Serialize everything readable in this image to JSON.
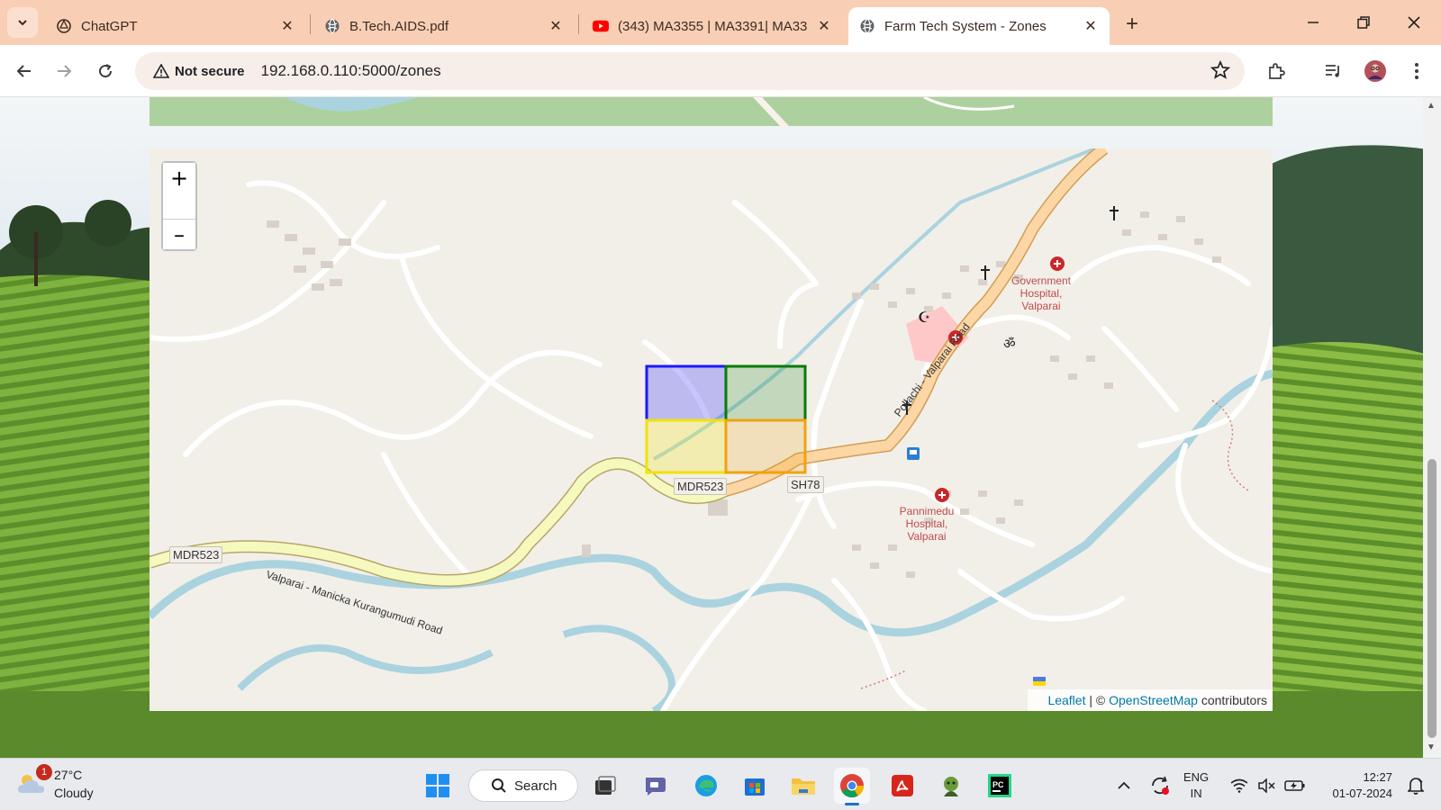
{
  "browser": {
    "tabs": [
      {
        "title": "ChatGPT",
        "icon": "chatgpt-icon",
        "active": false
      },
      {
        "title": "B.Tech.AIDS.pdf",
        "icon": "globe-icon",
        "active": false
      },
      {
        "title": "(343) MA3355 | MA3391| MA33",
        "icon": "youtube-icon",
        "active": false
      },
      {
        "title": "Farm Tech System - Zones",
        "icon": "globe-icon",
        "active": true
      }
    ],
    "security_label": "Not secure",
    "url": "192.168.0.110:5000/zones"
  },
  "map": {
    "zoom_in_label": "+",
    "zoom_out_label": "–",
    "attribution": {
      "leaflet": "Leaflet",
      "sep": " | © ",
      "osm": "OpenStreetMap",
      "suffix": " contributors"
    },
    "road_labels": [
      "MDR523",
      "MDR523",
      "SH78"
    ],
    "road_names": [
      "Valparai - Manicka Kurangumudi Road",
      "Pollachi - Valparai Road"
    ],
    "places": [
      {
        "name": "Government\nHospital,\nValparai"
      },
      {
        "name": "Pannimedu\nHospital,\nValparai"
      }
    ],
    "zones": [
      {
        "color": "#1a1aff"
      },
      {
        "color": "#0a7a0a"
      },
      {
        "color": "#f2e20a"
      },
      {
        "color": "#f2a20a"
      }
    ]
  },
  "taskbar": {
    "weather": {
      "temp": "27°C",
      "condition": "Cloudy",
      "badge": "1"
    },
    "search_label": "Search",
    "lang": {
      "line1": "ENG",
      "line2": "IN"
    },
    "clock": {
      "time": "12:27",
      "date": "01-07-2024"
    }
  }
}
